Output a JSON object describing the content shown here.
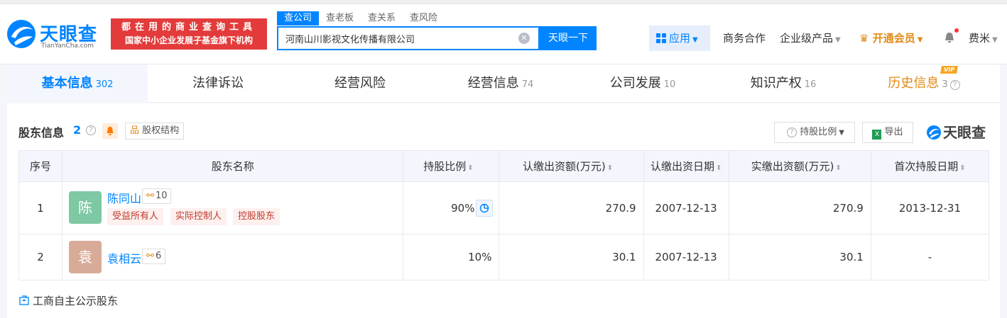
{
  "header": {
    "logo_text": "天眼查",
    "logo_domain": "TianYanCha.com",
    "slogan_line1": "都在用的商业查询工具",
    "slogan_line2": "国家中小企业发展子基金旗下机构",
    "search_tabs": [
      "查公司",
      "查老板",
      "查关系",
      "查风险"
    ],
    "search_value": "河南山川影视文化传播有限公司",
    "search_button": "天眼一下",
    "nav": {
      "app": "应用",
      "business": "商务合作",
      "enterprise": "企业级产品",
      "vip": "开通会员",
      "user": "费米"
    }
  },
  "tabs": [
    {
      "label": "基本信息",
      "count": "302"
    },
    {
      "label": "法律诉讼",
      "count": ""
    },
    {
      "label": "经营风险",
      "count": ""
    },
    {
      "label": "经营信息",
      "count": "74"
    },
    {
      "label": "公司发展",
      "count": "10"
    },
    {
      "label": "知识产权",
      "count": "16"
    },
    {
      "label": "历史信息",
      "count": "3",
      "badge": "VIP"
    }
  ],
  "section": {
    "title": "股东信息",
    "count": "2",
    "equity_button": "股权结构",
    "ratio_button": "持股比例",
    "export_button": "导出",
    "brand": "天眼查"
  },
  "table": {
    "headers": [
      "序号",
      "股东名称",
      "持股比例",
      "认缴出资额(万元)",
      "认缴出资日期",
      "实缴出资额(万元)",
      "首次持股日期"
    ],
    "rows": [
      {
        "no": "1",
        "avatar": "陈",
        "avatar_color": "#7ec8a4",
        "name": "陈同山",
        "relations": "10",
        "tags": [
          "受益所有人",
          "实际控制人",
          "控股股东"
        ],
        "ratio": "90%",
        "subscribed": "270.9",
        "subscribed_date": "2007-12-13",
        "paid": "270.9",
        "first_date": "2013-12-31"
      },
      {
        "no": "2",
        "avatar": "袁",
        "avatar_color": "#d8ab98",
        "name": "袁相云",
        "relations": "6",
        "tags": [],
        "ratio": "10%",
        "subscribed": "30.1",
        "subscribed_date": "2007-12-13",
        "paid": "30.1",
        "first_date": "-"
      }
    ]
  },
  "footer_link": "工商自主公示股东",
  "colors": {
    "brand_blue": "#0084ff",
    "slogan_red": "#e33b3b",
    "vip_orange": "#e08a16"
  }
}
